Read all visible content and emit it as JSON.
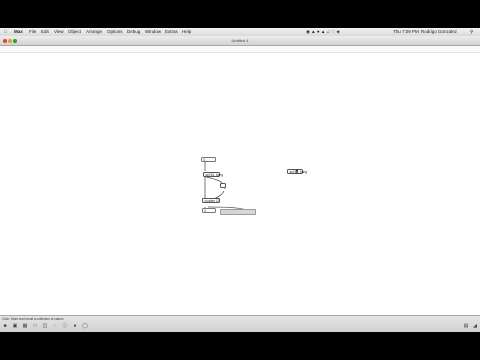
{
  "app": {
    "apple_icon": "apple-icon",
    "name": "Max",
    "menu": [
      "File",
      "Edit",
      "View",
      "Object",
      "Arrange",
      "Options",
      "Debug",
      "Window",
      "Extras",
      "Help"
    ]
  },
  "status_right": {
    "clock": "Thu 7:09 PM",
    "user": "Rodrigo Gonzalez",
    "search_icon": "search-icon"
  },
  "window": {
    "title": "Untitled 4"
  },
  "patch": {
    "number_top": "0",
    "message_left": "set $1, bang",
    "message_right": "set $1, bang",
    "object_mid": "counter 10",
    "number_bottom": "0",
    "slider_label": ""
  },
  "statusbar": {
    "hint": "Click: Store and recall a collection of values"
  },
  "colors": {
    "background": "#000000",
    "canvas": "#ffffff"
  }
}
